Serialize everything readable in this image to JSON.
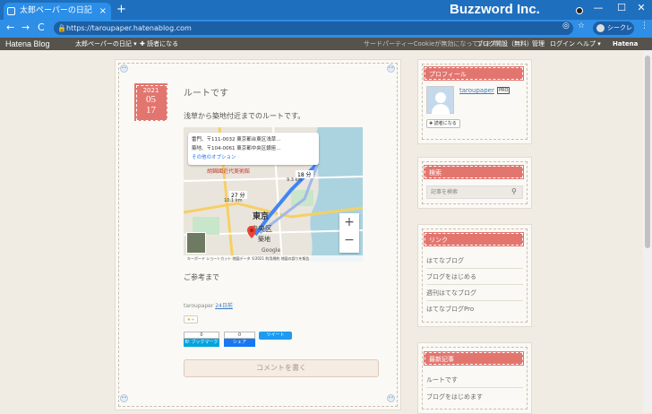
{
  "browser": {
    "tab_title": "太郎ペーパーの日記",
    "tab_close": "×",
    "new_tab": "+",
    "brand": "Buzzword Inc.",
    "min": "—",
    "max": "☐",
    "close": "✕",
    "back": "←",
    "forward": "→",
    "reload": "C",
    "url": "https://taroupaper.hatenablog.com",
    "incognito": "シークレット",
    "menu": "⋮"
  },
  "hatena_header": {
    "logo": "Hatena Blog",
    "blog_name": "太郎ペーパーの日記 ▾",
    "reader": "✚ 読者になる",
    "cookie_notice": "サードパーティーCookieが無効になっています",
    "open_blog": "ブログ開設（無料）",
    "admin": "管理",
    "login": "ログイン",
    "help": "ヘルプ ▾",
    "hatena": "Hatena"
  },
  "post": {
    "year": "2021",
    "month": "05",
    "day": "17",
    "title": "ルートです",
    "body": "浅草から築地付近までのルートです。",
    "closing": "ご参考まで",
    "author": "taroupaper",
    "time": "24日前",
    "star": "★+",
    "hatebu_count": "0",
    "hatebu_label": "B! ブックマーク",
    "fb_count": "0",
    "fb_label": "シェア",
    "tweet_label": "ツイート",
    "comment_button": "コメントを書く"
  },
  "map": {
    "origin": "雷門、〒111-0032 東京都台東区浅草…",
    "destination": "築地、〒104-0061 東京都中央区銀座…",
    "more": "その他のオプション",
    "city_label": "東京",
    "ward_label": "中央区",
    "poi_label": "築地",
    "zoom_in": "+",
    "zoom_out": "−",
    "footer": "キーボード ショートカット  地図データ ©2021  利用規約  地図の誤りを報告",
    "google": "Google",
    "car_time": "27 分",
    "car_dist": "10.1 km",
    "train_time": "18 分",
    "train_dist": "9.3 km",
    "poi_red": "胡錦國近代美術館"
  },
  "sidebar": {
    "profile_title": "プロフィール",
    "username": "taroupaper",
    "pro_badge": "PRO",
    "reader_button": "✚ 読者になる",
    "search_title": "検索",
    "search_placeholder": "記事を検索",
    "links_title": "リンク",
    "links": [
      "はてなブログ",
      "ブログをはじめる",
      "週刊はてなブログ",
      "はてなブログPro"
    ],
    "recent_title": "最新記事",
    "recent": [
      "ルートです",
      "ブログをはじめます"
    ]
  }
}
